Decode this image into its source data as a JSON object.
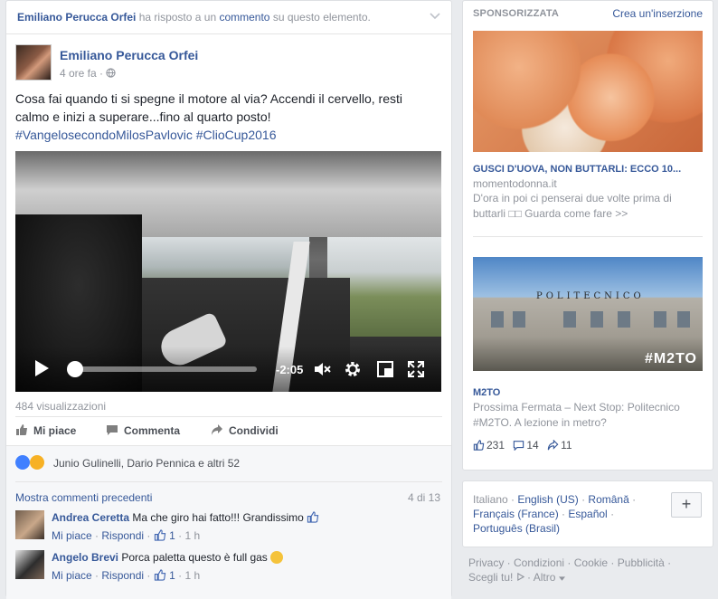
{
  "post": {
    "story_header": {
      "actor": "Emiliano Perucca Orfei",
      "mid_text": " ha risposto a un ",
      "link": "commento",
      "tail": " su questo elemento."
    },
    "author": "Emiliano Perucca Orfei",
    "time": "4 ore fa",
    "text_line1": "Cosa fai quando ti si spegne il motore al via? Accendi il cervello, resti",
    "text_line2": "calmo e inizi a superare...fino al quarto posto!",
    "hashtags": "#VangelosecondoMilosPavlovic #ClioCup2016",
    "video": {
      "time_remaining": "-2:05",
      "progress": 0.02
    },
    "views": "484 visualizzazioni",
    "actions": {
      "like": "Mi piace",
      "comment": "Commenta",
      "share": "Condividi"
    },
    "reactions_text": "Junio Gulinelli, Dario Pennica e altri 52",
    "more_comments": "Mostra commenti precedenti",
    "comment_count": "4 di 13",
    "comments": [
      {
        "author": "Andrea Ceretta",
        "text": "Ma che giro hai fatto!!! Grandissimo",
        "like": "Mi piace",
        "reply": "Rispondi",
        "likes": "1",
        "time": "1 h"
      },
      {
        "author": "Angelo Brevi",
        "text": "Porca paletta questo è full gas",
        "like": "Mi piace",
        "reply": "Rispondi",
        "likes": "1",
        "time": "1 h"
      }
    ]
  },
  "ads": {
    "header": "SPONSORIZZATA",
    "create": "Crea un'inserzione",
    "ad1": {
      "title": "GUSCI D'UOVA, NON BUTTARLI: ECCO 10...",
      "domain": "momentodonna.it",
      "desc": "D'ora in poi ci penserai due volte prima di buttarli □□ Guarda come fare >>"
    },
    "ad2": {
      "image_building_text": "POLITECNICO",
      "image_brand": "#M2TO",
      "name": "M2TO",
      "desc": "Prossima Fermata – Next Stop: Politecnico #M2TO. A lezione in metro?",
      "likes": "231",
      "comments": "14",
      "shares": "11"
    }
  },
  "languages": {
    "current": "Italiano",
    "sep": " · ",
    "links": [
      "English (US)",
      "Română",
      "Français (France)",
      "Español",
      "Português (Brasil)"
    ]
  },
  "footer": {
    "links": [
      "Privacy",
      "Condizioni",
      "Cookie",
      "Pubblicità",
      "Scegli tu!",
      "Altro"
    ]
  },
  "colors": {
    "link": "#365899",
    "muted": "#90949c",
    "page_bg": "#e9ebee"
  }
}
